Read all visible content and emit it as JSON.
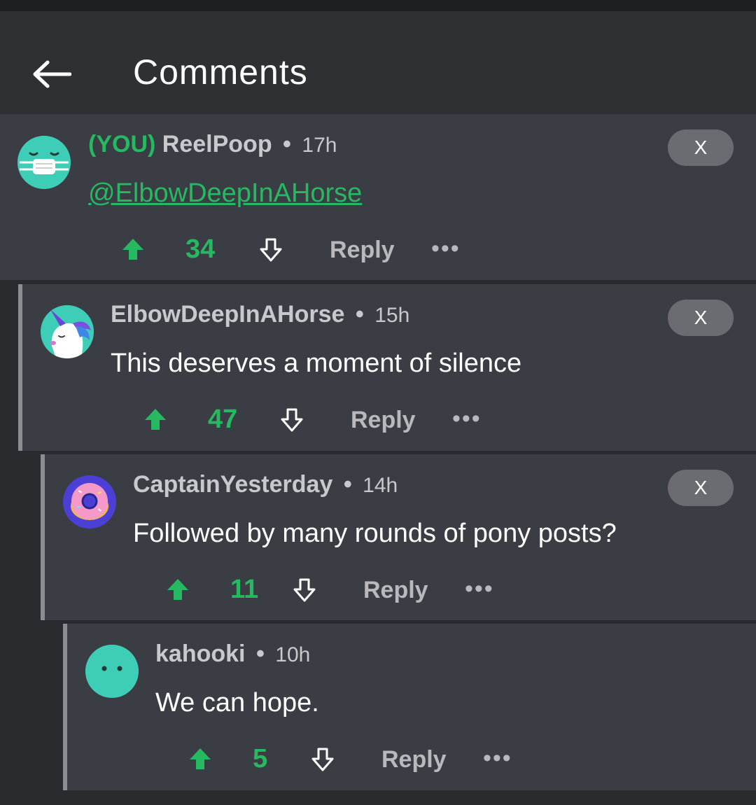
{
  "header": {
    "title": "Comments",
    "back_icon": "arrow-left-icon"
  },
  "colors": {
    "accent_green": "#27b862",
    "card_bg": "#3b3d44",
    "thread_line": "#8b8d93"
  },
  "comments": [
    {
      "you_tag": "(YOU)",
      "author": "ReelPoop",
      "time": "17h",
      "mention": "@ElbowDeepInAHorse",
      "text": "",
      "score": "34",
      "reply": "Reply",
      "more": "•••",
      "close": "X",
      "avatar": "masked-face-avatar"
    },
    {
      "author": "ElbowDeepInAHorse",
      "time": "15h",
      "text": "This deserves a moment of silence",
      "score": "47",
      "reply": "Reply",
      "more": "•••",
      "close": "X",
      "avatar": "unicorn-avatar"
    },
    {
      "author": "CaptainYesterday",
      "time": "14h",
      "text": "Followed by many rounds of pony posts?",
      "score": "11",
      "reply": "Reply",
      "more": "•••",
      "close": "X",
      "avatar": "donut-avatar"
    },
    {
      "author": "kahooki",
      "time": "10h",
      "text": "We can hope.",
      "score": "5",
      "reply": "Reply",
      "more": "•••",
      "avatar": "neutral-face-avatar"
    }
  ],
  "separator": "•"
}
